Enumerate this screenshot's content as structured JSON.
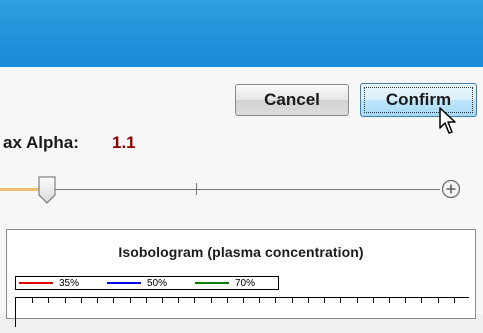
{
  "dialog": {
    "buttons": {
      "cancel_label": "Cancel",
      "confirm_label": "Confirm"
    },
    "max_alpha": {
      "label": "ax Alpha:",
      "value": "1.1",
      "value_color": "#8b0000"
    },
    "slider": {
      "position_fraction": 0.1,
      "plus_icon": "plus-circle-icon"
    }
  },
  "chart_data": {
    "type": "line",
    "title": "Isobologram (plasma concentration)",
    "series": [
      {
        "name": "35%",
        "color": "#e00000",
        "values": []
      },
      {
        "name": "50%",
        "color": "#0000e0",
        "values": []
      },
      {
        "name": "70%",
        "color": "#008000",
        "values": []
      }
    ],
    "legend_position": "top-left",
    "grid": false
  },
  "colors": {
    "titlebar": "#1a89d6",
    "accent_slider": "#f0c070"
  }
}
